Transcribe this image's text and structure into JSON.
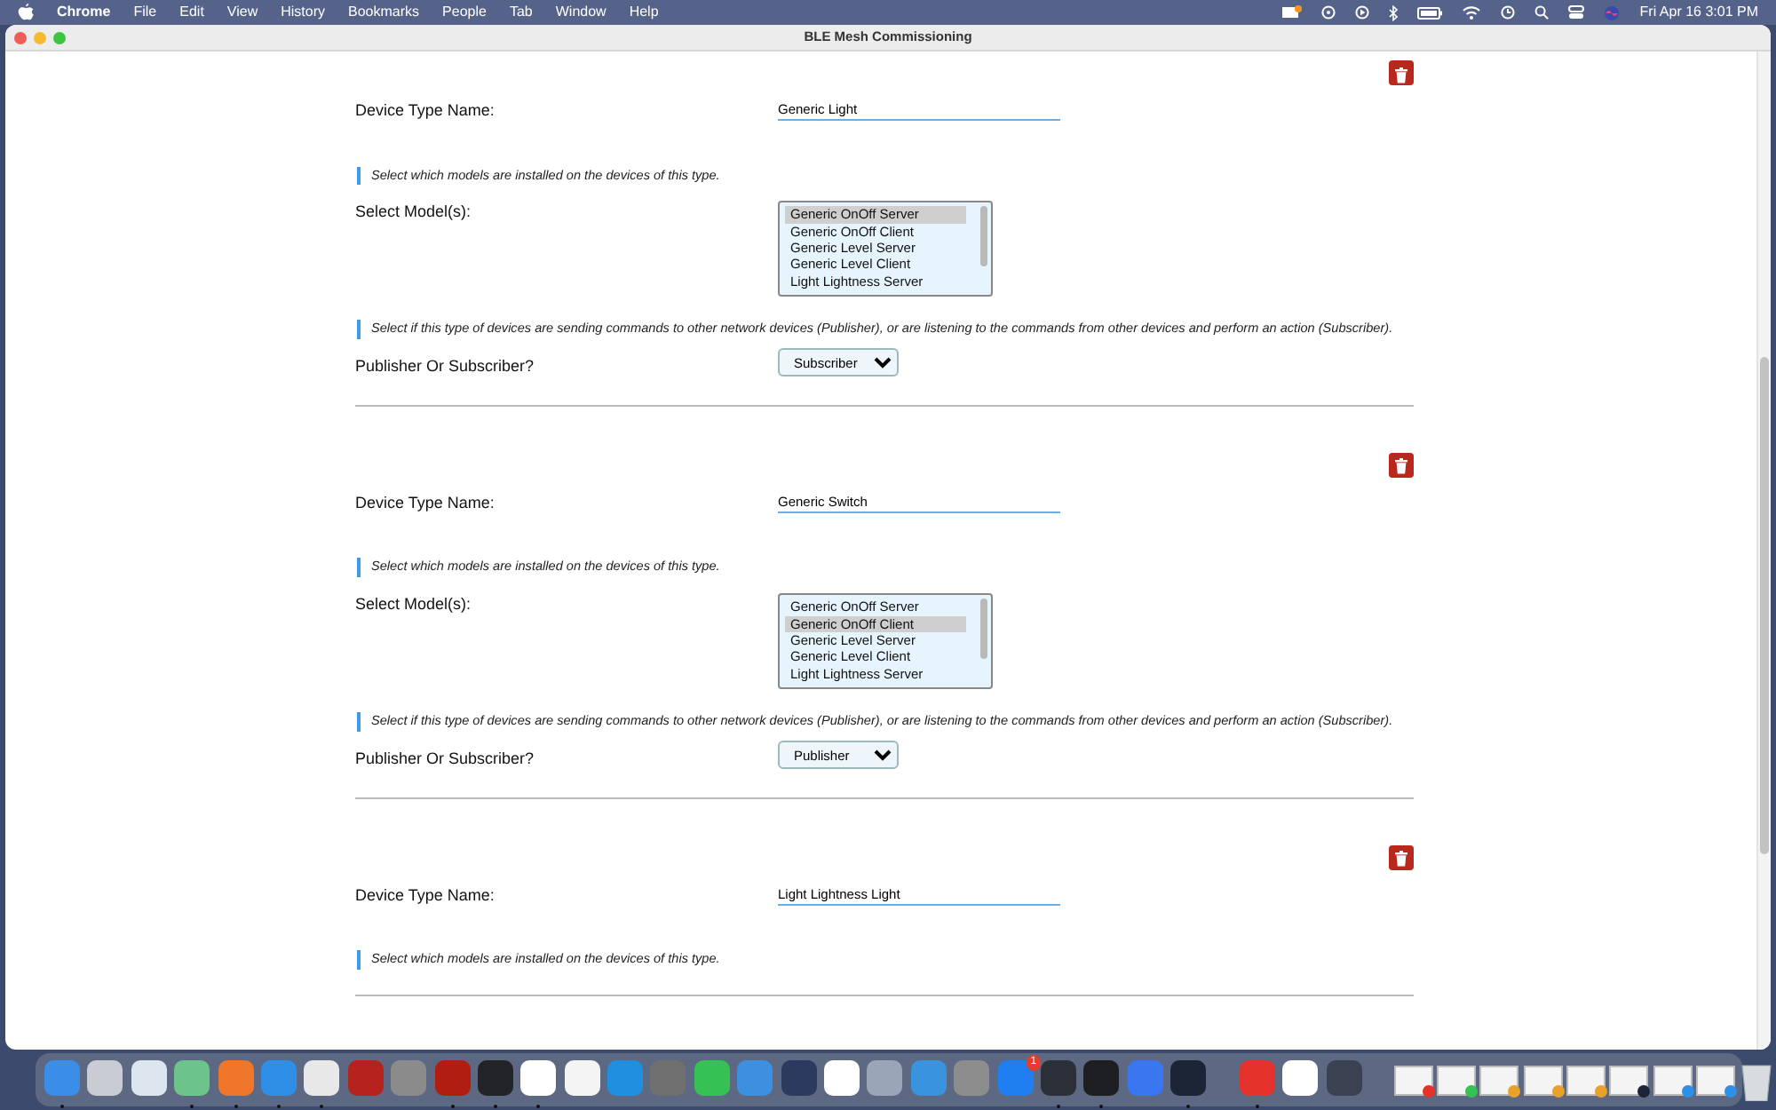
{
  "menu_bar": {
    "app": "Chrome",
    "menus": [
      "File",
      "Edit",
      "View",
      "History",
      "Bookmarks",
      "People",
      "Tab",
      "Window",
      "Help"
    ],
    "clock": "Fri Apr 16  3:01 PM"
  },
  "window": {
    "title": "BLE Mesh Commissioning"
  },
  "device_types": [
    {
      "name_label": "Device Type Name:",
      "name_value": "Generic Light",
      "models_hint": "Select which models are installed on the devices of this type.",
      "models_label": "Select Model(s):",
      "models": [
        {
          "label": "Generic OnOff Server",
          "selected": true
        },
        {
          "label": "Generic OnOff Client",
          "selected": false
        },
        {
          "label": "Generic Level Server",
          "selected": false
        },
        {
          "label": "Generic Level Client",
          "selected": false
        },
        {
          "label": "Light Lightness Server",
          "selected": false
        }
      ],
      "role_hint": "Select if this type of devices are sending commands to other network devices (Publisher), or are listening to the commands from other devices and perform an action (Subscriber).",
      "role_label": "Publisher Or Subscriber?",
      "role_value": "Subscriber"
    },
    {
      "name_label": "Device Type Name:",
      "name_value": "Generic Switch",
      "models_hint": "Select which models are installed on the devices of this type.",
      "models_label": "Select Model(s):",
      "models": [
        {
          "label": "Generic OnOff Server",
          "selected": false
        },
        {
          "label": "Generic OnOff Client",
          "selected": true
        },
        {
          "label": "Generic Level Server",
          "selected": false
        },
        {
          "label": "Generic Level Client",
          "selected": false
        },
        {
          "label": "Light Lightness Server",
          "selected": false
        }
      ],
      "role_hint": "Select if this type of devices are sending commands to other network devices (Publisher), or are listening to the commands from other devices and perform an action (Subscriber).",
      "role_label": "Publisher Or Subscriber?",
      "role_value": "Publisher"
    },
    {
      "name_label": "Device Type Name:",
      "name_value": "Light Lightness Light",
      "models_hint": "Select which models are installed on the devices of this type."
    }
  ],
  "dock": {
    "apps": [
      {
        "color": "#3b8ee8",
        "running": true
      },
      {
        "color": "#c9ccd3",
        "running": false
      },
      {
        "color": "#dde6ef",
        "running": false
      },
      {
        "color": "#6cc48a",
        "running": true
      },
      {
        "color": "#f0762a",
        "running": true
      },
      {
        "color": "#2f8fe6",
        "running": true
      },
      {
        "color": "#e8e8e8",
        "running": true
      },
      {
        "color": "#b5231c",
        "running": false
      },
      {
        "color": "#8b8b8b",
        "running": false
      },
      {
        "color": "#b21d12",
        "running": true
      },
      {
        "color": "#222428",
        "running": true
      },
      {
        "color": "#ffffff",
        "running": true
      },
      {
        "color": "#f4f4f4",
        "running": false
      },
      {
        "color": "#1f8fe0",
        "running": false
      },
      {
        "color": "#707070",
        "running": false
      },
      {
        "color": "#36c154",
        "running": false
      },
      {
        "color": "#3d8fe0",
        "running": false
      },
      {
        "color": "#2b3a5e",
        "running": false
      },
      {
        "color": "#ffffff",
        "running": false
      },
      {
        "color": "#9aa5b8",
        "running": false
      },
      {
        "color": "#3a93dd",
        "running": false
      },
      {
        "color": "#8d8d8d",
        "running": false
      },
      {
        "color": "#1f7ef0",
        "running": false,
        "badge": "1"
      },
      {
        "color": "#2c3139",
        "running": true
      },
      {
        "color": "#1c1e22",
        "running": true
      },
      {
        "color": "#3a76f0",
        "running": false
      },
      {
        "color": "#1b2536",
        "running": true
      }
    ],
    "recent": [
      {
        "color": "#e5322b",
        "running": true
      },
      {
        "color": "#ffffff",
        "running": false
      },
      {
        "color": "#3a4150",
        "running": false
      }
    ],
    "windows": [
      {
        "color": "#e5322b"
      },
      {
        "color": "#36c154"
      },
      {
        "color": "#e8a22b"
      },
      {
        "color": "#e8a22b"
      },
      {
        "color": "#e8a22b"
      },
      {
        "color": "#1b2536"
      },
      {
        "color": "#2f8fe6"
      },
      {
        "color": "#2f8fe6"
      }
    ]
  }
}
